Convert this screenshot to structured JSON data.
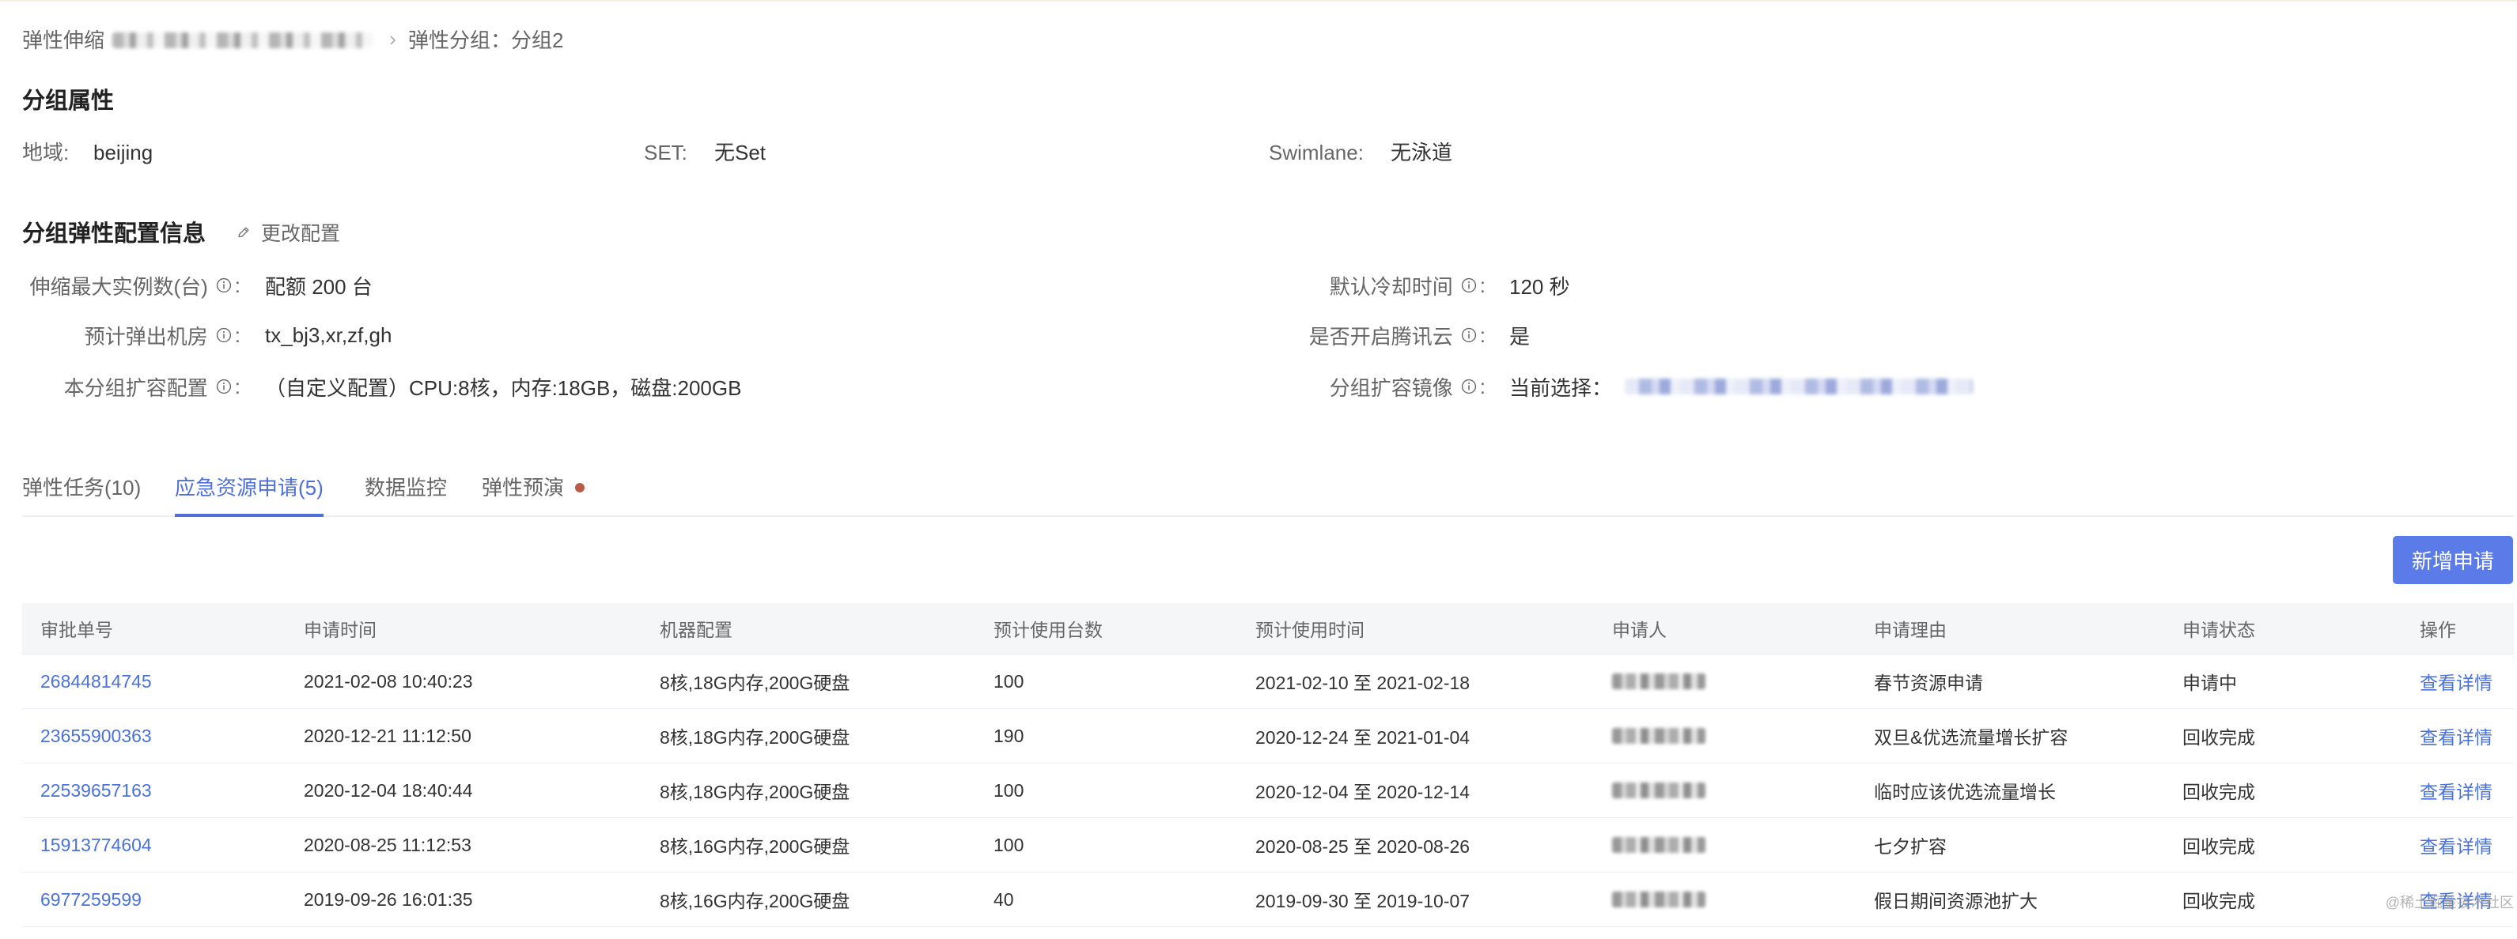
{
  "colors": {
    "accent": "#4e6fd8",
    "button_bg": "#5b7be9",
    "link": "#4a72d9",
    "dot": "#b85c4a",
    "header_bg": "#f5f6f8"
  },
  "icons": {
    "breadcrumb_separator": "chevron-right-icon",
    "edit": "edit-icon",
    "info": "info-icon"
  },
  "breadcrumb": {
    "root": "弹性伸缩",
    "current": "弹性分组：分组2"
  },
  "group_attributes": {
    "title": "分组属性",
    "region": {
      "label": "地域:",
      "value": "beijing"
    },
    "set": {
      "label": "SET:",
      "value": "无Set"
    },
    "swimlane": {
      "label": "Swimlane:",
      "value": "无泳道"
    }
  },
  "elastic_config": {
    "title": "分组弹性配置信息",
    "edit_label": "更改配置",
    "label_colon": ":",
    "max_instances": {
      "label": "伸缩最大实例数(台)",
      "value": "配额 200 台"
    },
    "cooldown": {
      "label": "默认冷却时间",
      "value": "120 秒"
    },
    "expected_zones": {
      "label": "预计弹出机房",
      "value": "tx_bj3,xr,zf,gh"
    },
    "tencent_cloud": {
      "label": "是否开启腾讯云",
      "value": "是"
    },
    "scale_spec": {
      "label": "本分组扩容配置",
      "value": "（自定义配置）CPU:8核，内存:18GB，磁盘:200GB"
    },
    "image": {
      "label": "分组扩容镜像",
      "value_prefix": "当前选择："
    }
  },
  "tabs": [
    {
      "label": "弹性任务(10)",
      "active": false,
      "has_dot": false
    },
    {
      "label": "应急资源申请(5)",
      "active": true,
      "has_dot": false
    },
    {
      "label": "数据监控",
      "active": false,
      "has_dot": false
    },
    {
      "label": "弹性预演",
      "active": false,
      "has_dot": true
    }
  ],
  "add_button_label": "新增申请",
  "table": {
    "columns": [
      "审批单号",
      "申请时间",
      "机器配置",
      "预计使用台数",
      "预计使用时间",
      "申请人",
      "申请理由",
      "申请状态",
      "操作"
    ],
    "rows": [
      {
        "id": "26844814745",
        "apply_time": "2021-02-08 10:40:23",
        "machine_config": "8核,18G内存,200G硬盘",
        "count": "100",
        "use_period": "2021-02-10 至 2021-02-18",
        "reason": "春节资源申请",
        "status": "申请中",
        "action": "查看详情"
      },
      {
        "id": "23655900363",
        "apply_time": "2020-12-21 11:12:50",
        "machine_config": "8核,18G内存,200G硬盘",
        "count": "190",
        "use_period": "2020-12-24 至 2021-01-04",
        "reason": "双旦&优选流量增长扩容",
        "status": "回收完成",
        "action": "查看详情"
      },
      {
        "id": "22539657163",
        "apply_time": "2020-12-04 18:40:44",
        "machine_config": "8核,18G内存,200G硬盘",
        "count": "100",
        "use_period": "2020-12-04 至 2020-12-14",
        "reason": "临时应该优选流量增长",
        "status": "回收完成",
        "action": "查看详情"
      },
      {
        "id": "15913774604",
        "apply_time": "2020-08-25 11:12:53",
        "machine_config": "8核,16G内存,200G硬盘",
        "count": "100",
        "use_period": "2020-08-25 至 2020-08-26",
        "reason": "七夕扩容",
        "status": "回收完成",
        "action": "查看详情"
      },
      {
        "id": "6977259599",
        "apply_time": "2019-09-26 16:01:35",
        "machine_config": "8核,16G内存,200G硬盘",
        "count": "40",
        "use_period": "2019-09-30 至 2019-10-07",
        "reason": "假日期间资源池扩大",
        "status": "回收完成",
        "action": "查看详情"
      }
    ]
  },
  "watermark": "@稀土掘金技术社区"
}
